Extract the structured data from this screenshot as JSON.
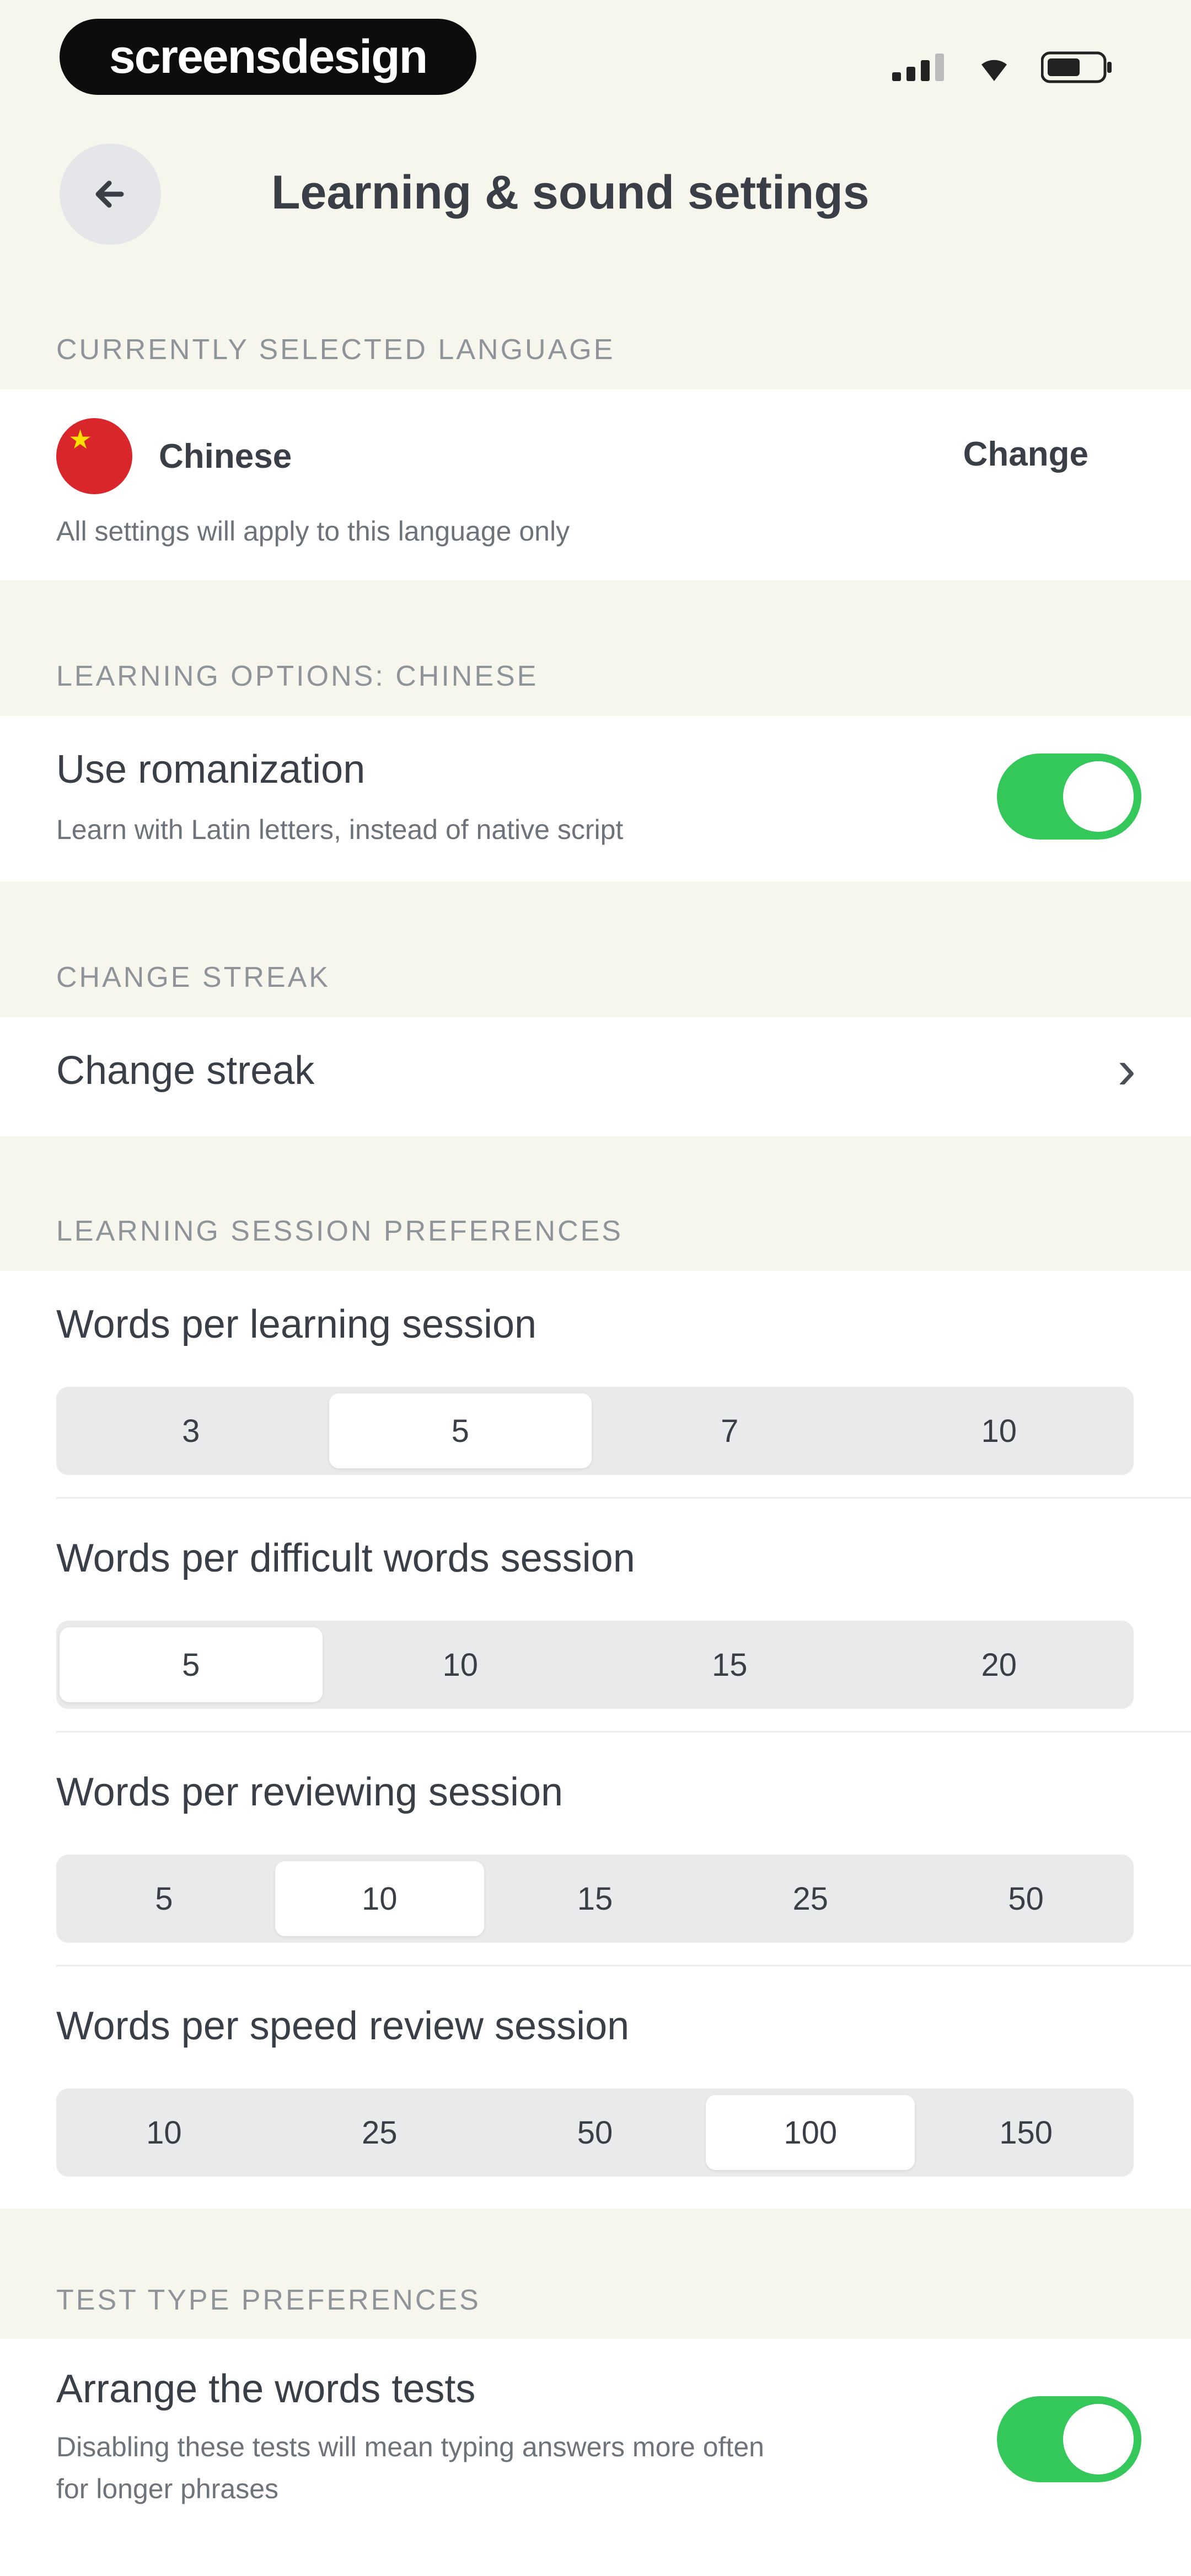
{
  "status_bar": {
    "brand": "screensdesign",
    "icons": [
      "signal-icon",
      "wifi-icon",
      "battery-icon"
    ]
  },
  "header": {
    "title": "Learning & sound settings",
    "back_icon": "arrow-left-icon"
  },
  "language_section": {
    "label": "CURRENTLY SELECTED LANGUAGE",
    "language": "Chinese",
    "change": "Change",
    "note": "All settings will apply to this language only"
  },
  "learning_options": {
    "label": "LEARNING OPTIONS: CHINESE",
    "romanization_title": "Use romanization",
    "romanization_sub": "Learn with Latin letters, instead of native script",
    "romanization_on": true
  },
  "streak_section": {
    "label": "CHANGE STREAK",
    "row": "Change streak"
  },
  "session_prefs": {
    "label": "LEARNING SESSION PREFERENCES",
    "groups": [
      {
        "title": "Words per learning session",
        "options": [
          "3",
          "5",
          "7",
          "10"
        ],
        "selected": "5"
      },
      {
        "title": "Words per difficult words session",
        "options": [
          "5",
          "10",
          "15",
          "20"
        ],
        "selected": "5"
      },
      {
        "title": "Words per reviewing session",
        "options": [
          "5",
          "10",
          "15",
          "25",
          "50"
        ],
        "selected": "10"
      },
      {
        "title": "Words per speed review session",
        "options": [
          "10",
          "25",
          "50",
          "100",
          "150"
        ],
        "selected": "100"
      }
    ]
  },
  "test_prefs": {
    "label": "TEST TYPE PREFERENCES",
    "arrange_title": "Arrange the words tests",
    "arrange_sub_1": "Disabling these tests will mean typing answers more often",
    "arrange_sub_2": "for longer phrases",
    "arrange_on": true
  },
  "colors": {
    "background": "#f6f6ec",
    "toggle_on": "#34c759",
    "flag_red": "#d9262b"
  }
}
